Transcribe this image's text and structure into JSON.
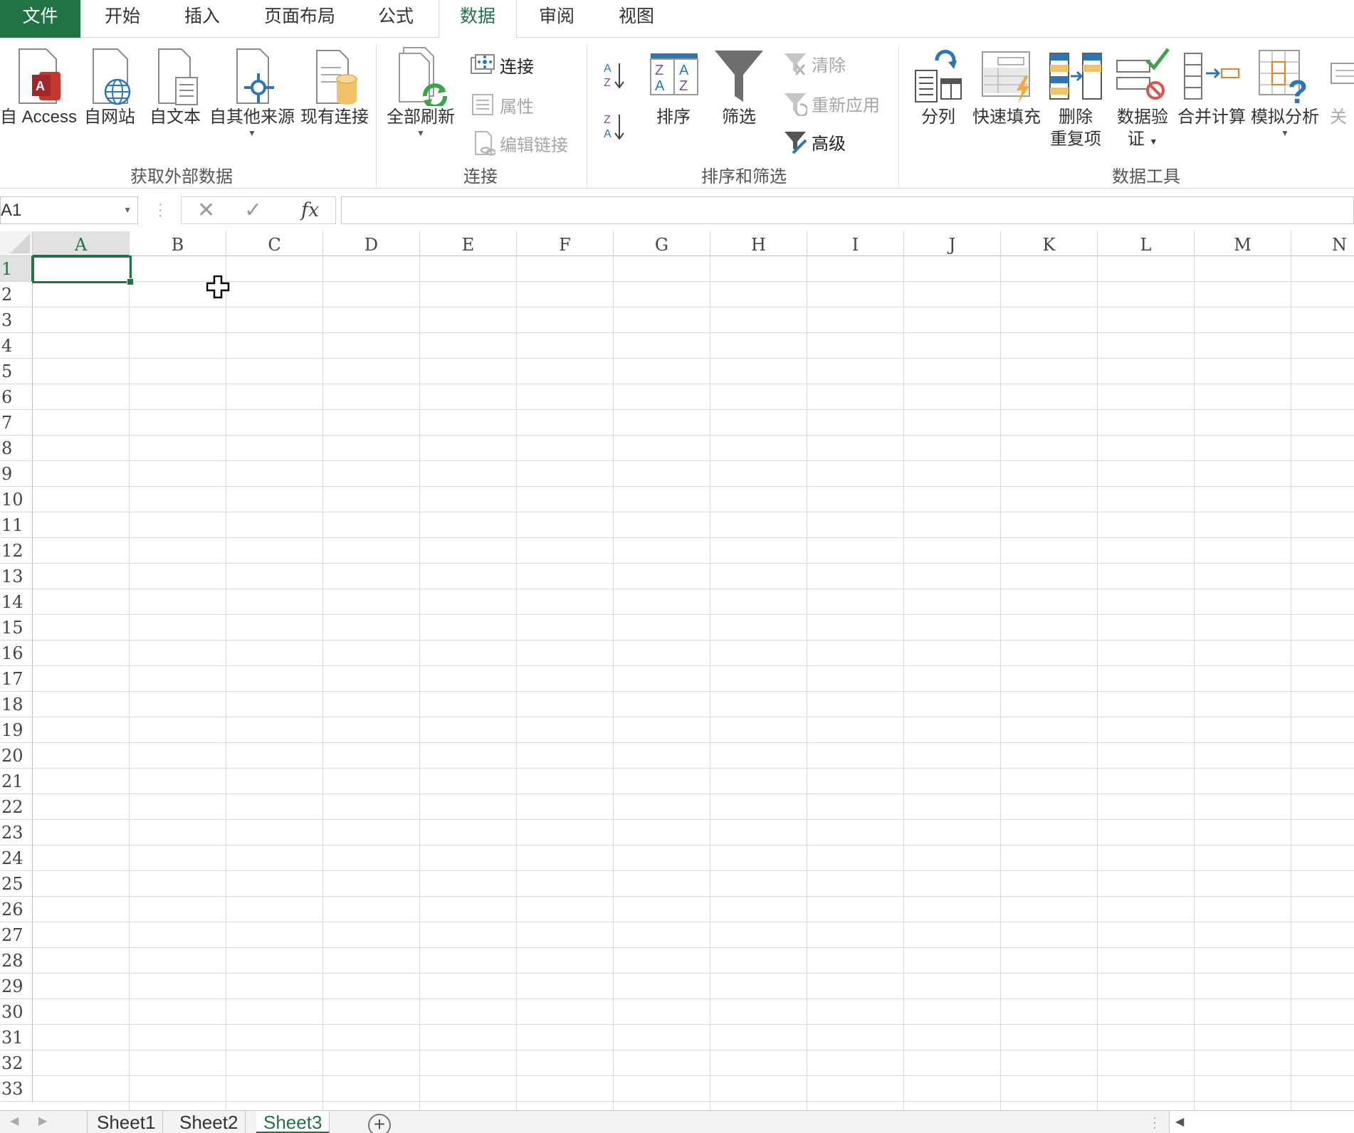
{
  "tabs": {
    "file": "文件",
    "home": "开始",
    "insert": "插入",
    "layout": "页面布局",
    "formulas": "公式",
    "data": "数据",
    "review": "审阅",
    "view": "视图"
  },
  "ribbon": {
    "get_external": {
      "group_label": "获取外部数据",
      "access": "自 Access",
      "web": "自网站",
      "text": "自文本",
      "other": "自其他来源",
      "existing": "现有连接"
    },
    "connections": {
      "group_label": "连接",
      "refresh_all": "全部刷新",
      "connections": "连接",
      "properties": "属性",
      "edit_links": "编辑链接"
    },
    "sort_filter": {
      "group_label": "排序和筛选",
      "sort": "排序",
      "filter": "筛选",
      "clear": "清除",
      "reapply": "重新应用",
      "advanced": "高级"
    },
    "data_tools": {
      "group_label": "数据工具",
      "text_to_columns": "分列",
      "flash_fill": "快速填充",
      "remove_dup_1": "删除",
      "remove_dup_2": "重复项",
      "validation_1": "数据验",
      "validation_2": "证",
      "consolidate": "合并计算",
      "what_if": "模拟分析",
      "relationships": "关"
    }
  },
  "formula_bar": {
    "name_box": "A1",
    "fx": "fx",
    "value": ""
  },
  "grid": {
    "columns": [
      "A",
      "B",
      "C",
      "D",
      "E",
      "F",
      "G",
      "H",
      "I",
      "J",
      "K",
      "L",
      "M",
      "N"
    ],
    "rows": [
      "1",
      "2",
      "3",
      "4",
      "5",
      "6",
      "7",
      "8",
      "9",
      "10",
      "11",
      "12",
      "13",
      "14",
      "15",
      "16",
      "17",
      "18",
      "19",
      "20",
      "21",
      "22",
      "23",
      "24",
      "25",
      "26",
      "27",
      "28",
      "29",
      "30",
      "31",
      "32",
      "33"
    ],
    "selected_cell": "A1"
  },
  "sheets": [
    "Sheet1",
    "Sheet2",
    "Sheet3"
  ],
  "active_sheet": "Sheet3",
  "colors": {
    "accent": "#217346",
    "access_red": "#c0392b",
    "blue_icon": "#2e75b6",
    "gold_icon": "#f2c26b"
  }
}
